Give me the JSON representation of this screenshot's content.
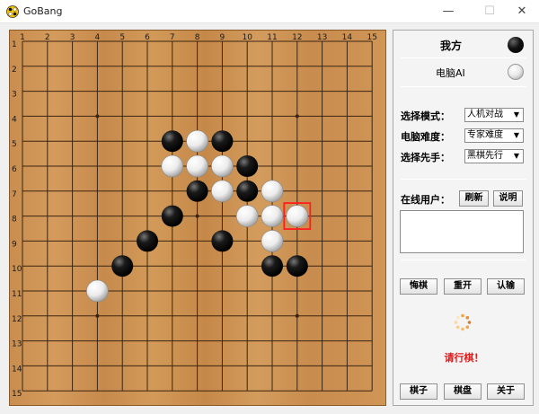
{
  "window": {
    "title": "GoBang",
    "min_glyph": "—",
    "max_glyph": "☐",
    "close_glyph": "✕"
  },
  "board": {
    "size": 15,
    "col_labels": [
      "1",
      "2",
      "3",
      "4",
      "5",
      "6",
      "7",
      "8",
      "9",
      "10",
      "11",
      "12",
      "13",
      "14",
      "15"
    ],
    "row_labels": [
      "1",
      "2",
      "3",
      "4",
      "5",
      "6",
      "7",
      "8",
      "9",
      "10",
      "11",
      "12",
      "13",
      "14",
      "15"
    ],
    "star_points": [
      [
        4,
        4
      ],
      [
        12,
        4
      ],
      [
        8,
        8
      ],
      [
        4,
        12
      ],
      [
        12,
        12
      ]
    ],
    "black_stones": [
      [
        7,
        5
      ],
      [
        9,
        5
      ],
      [
        10,
        6
      ],
      [
        8,
        7
      ],
      [
        10,
        7
      ],
      [
        7,
        8
      ],
      [
        6,
        9
      ],
      [
        9,
        9
      ],
      [
        5,
        10
      ],
      [
        11,
        10
      ],
      [
        12,
        10
      ]
    ],
    "white_stones": [
      [
        8,
        5
      ],
      [
        7,
        6
      ],
      [
        8,
        6
      ],
      [
        9,
        6
      ],
      [
        9,
        7
      ],
      [
        11,
        7
      ],
      [
        10,
        8
      ],
      [
        11,
        8
      ],
      [
        12,
        8
      ],
      [
        11,
        9
      ],
      [
        4,
        11
      ]
    ],
    "last_move": [
      12,
      8
    ],
    "colors": {
      "grid": "#3a2410",
      "label": "#1a1a1a",
      "last_move": "#ff1f1f"
    }
  },
  "panel": {
    "my_side_label": "我方",
    "ai_side_label": "电脑AI",
    "mode_label": "选择模式：",
    "mode_value": "人机对战",
    "difficulty_label": "电脑难度：",
    "difficulty_value": "专家难度",
    "first_label": "选择先手：",
    "first_value": "黑棋先行",
    "online_label": "在线用户：",
    "refresh_button": "刷新",
    "help_button": "说明",
    "undo_button": "悔棋",
    "restart_button": "重开",
    "resign_button": "认输",
    "status": "请行棋！",
    "stone_button": "棋子",
    "board_button": "棋盘",
    "about_button": "关于",
    "status_color": "#e01818"
  }
}
